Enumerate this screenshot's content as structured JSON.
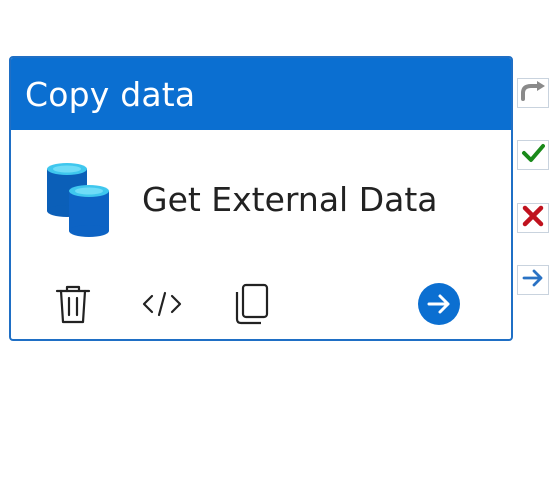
{
  "activity": {
    "type_label": "Copy data",
    "name": "Get External Data"
  },
  "icons": {
    "activity_icon": "database-icon",
    "toolbar": [
      "trash-icon",
      "code-icon",
      "copy-icon",
      "arrow-right-circle-icon"
    ],
    "side": [
      "redo-arrow-icon",
      "checkmark-icon",
      "x-icon",
      "arrow-right-icon"
    ]
  },
  "colors": {
    "header": "#0b6fd1",
    "accent": "#0b6fd1",
    "success": "#1a8a1a",
    "failure": "#c0121e",
    "completion": "#2a72c4",
    "skip": "#8a8a8a"
  }
}
